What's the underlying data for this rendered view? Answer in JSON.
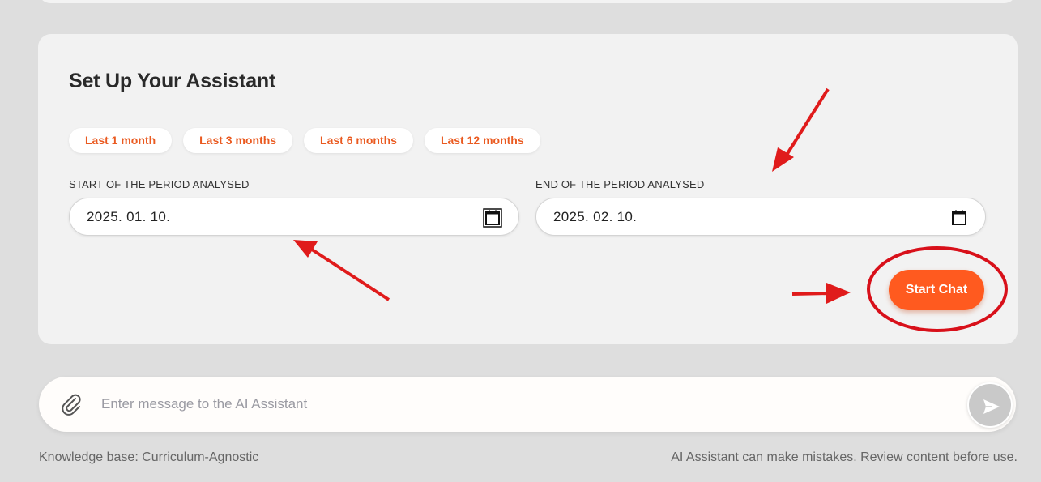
{
  "setup": {
    "title": "Set Up Your Assistant",
    "chips": [
      "Last 1 month",
      "Last 3 months",
      "Last 6 months",
      "Last 12 months"
    ],
    "start_label": "START OF THE PERIOD ANALYSED",
    "start_value": "2025. 01. 10.",
    "end_label": "END OF THE PERIOD ANALYSED",
    "end_value": "2025. 02. 10.",
    "start_chat_label": "Start Chat",
    "accent_color": "#ff5a1f",
    "annotation_color": "#e01b1b"
  },
  "message": {
    "placeholder": "Enter message to the AI Assistant"
  },
  "footer": {
    "knowledge_base": "Knowledge base: Curriculum-Agnostic",
    "disclaimer": "AI Assistant can make mistakes. Review content before use."
  }
}
